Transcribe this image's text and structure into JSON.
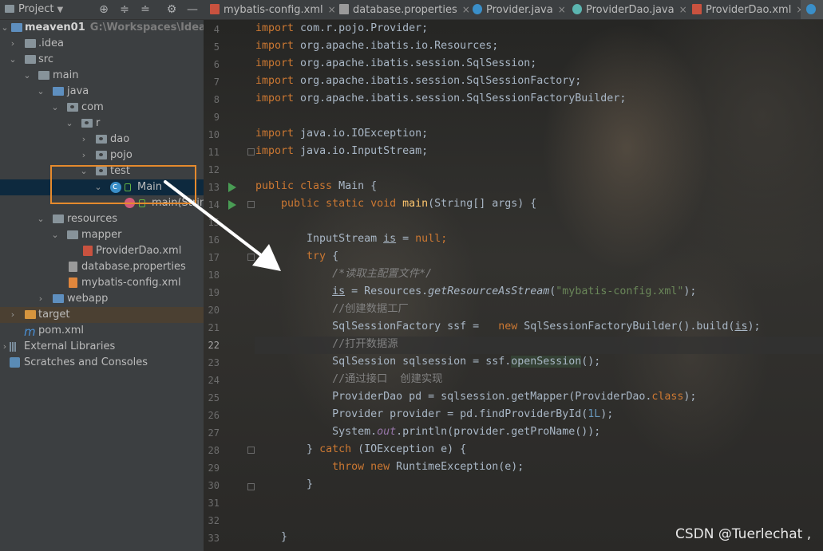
{
  "project_panel": {
    "title": "Project",
    "toolbar_icons": [
      "crosshair-icon",
      "expand-all-icon",
      "collapse-all-icon",
      "gear-icon",
      "hide-icon"
    ],
    "tree": [
      {
        "label": "meaven01",
        "path": "G:\\Workspaces\\IdeaProjec",
        "chevron": "down",
        "icon": "module-folder"
      },
      {
        "label": ".idea",
        "chevron": "right",
        "icon": "folder"
      },
      {
        "label": "src",
        "chevron": "down",
        "icon": "folder"
      },
      {
        "label": "main",
        "chevron": "down",
        "icon": "folder"
      },
      {
        "label": "java",
        "chevron": "down",
        "icon": "source-folder"
      },
      {
        "label": "com",
        "chevron": "down",
        "icon": "package"
      },
      {
        "label": "r",
        "chevron": "down",
        "icon": "package"
      },
      {
        "label": "dao",
        "chevron": "right",
        "icon": "package"
      },
      {
        "label": "pojo",
        "chevron": "right",
        "icon": "package"
      },
      {
        "label": "test",
        "chevron": "down",
        "icon": "package"
      },
      {
        "label": "Main",
        "chevron": "down",
        "icon": "class"
      },
      {
        "label": "main(Strin",
        "chevron": "",
        "icon": "method"
      },
      {
        "label": "resources",
        "chevron": "down",
        "icon": "resources-folder"
      },
      {
        "label": "mapper",
        "chevron": "down",
        "icon": "folder"
      },
      {
        "label": "ProviderDao.xml",
        "chevron": "",
        "icon": "xml-file"
      },
      {
        "label": "database.properties",
        "chevron": "",
        "icon": "properties-file"
      },
      {
        "label": "mybatis-config.xml",
        "chevron": "",
        "icon": "xml-file"
      },
      {
        "label": "webapp",
        "chevron": "right",
        "icon": "web-folder"
      },
      {
        "label": "target",
        "chevron": "right",
        "icon": "excluded-folder"
      },
      {
        "label": "pom.xml",
        "chevron": "",
        "icon": "maven-file"
      },
      {
        "label": "External Libraries",
        "chevron": "right",
        "icon": "libraries"
      },
      {
        "label": "Scratches and Consoles",
        "chevron": "",
        "icon": "scratches"
      }
    ]
  },
  "tabs": [
    {
      "label": "mybatis-config.xml",
      "icon": "xml-icon"
    },
    {
      "label": "database.properties",
      "icon": "properties-icon"
    },
    {
      "label": "Provider.java",
      "icon": "class-icon"
    },
    {
      "label": "ProviderDao.java",
      "icon": "interface-icon"
    },
    {
      "label": "ProviderDao.xml",
      "icon": "xml-icon"
    }
  ],
  "editor": {
    "line_numbers": [
      "4",
      "5",
      "6",
      "7",
      "8",
      "9",
      "10",
      "11",
      "12",
      "13",
      "14",
      "15",
      "16",
      "17",
      "18",
      "19",
      "20",
      "21",
      "22",
      "23",
      "24",
      "25",
      "26",
      "27",
      "28",
      "29",
      "30",
      "31",
      "32",
      "33"
    ],
    "current_line": "22",
    "tokens": {
      "l4a": "import",
      "l4b": " com.r.pojo.Provider;",
      "l5a": "import",
      "l5b": " org.apache.ibatis.io.Resources;",
      "l6a": "import",
      "l6b": " org.apache.ibatis.session.SqlSession;",
      "l7a": "import",
      "l7b": " org.apache.ibatis.session.SqlSessionFactory;",
      "l8a": "import",
      "l8b": " org.apache.ibatis.session.SqlSessionFactoryBuilder;",
      "l10a": "import",
      "l10b": " java.io.IOException;",
      "l11a": "import",
      "l11b": " java.io.InputStream;",
      "l13a": "public class",
      "l13b": " Main {",
      "l14a": "    public static void ",
      "l14b": "main",
      "l14c": "(String[] args) {",
      "l16a": "        InputStream ",
      "l16b": "is",
      "l16c": " = ",
      "l16d": "null",
      "l16e": ";",
      "l17a": "        try",
      "l17b": " {",
      "l18a": "            /*读取主配置文件*/",
      "l19a": "            ",
      "l19b": "is",
      "l19c": " = Resources.",
      "l19d": "getResourceAsStream",
      "l19e": "(",
      "l19f": "\"mybatis-config.xml\"",
      "l19g": ");",
      "l20a": "            //创建数据工厂",
      "l21a": "            SqlSessionFactory ssf =   ",
      "l21b": "new",
      "l21c": " SqlSessionFactoryBuilder().build(",
      "l21d": "is",
      "l21e": ");",
      "l22a": "            //打开数据源",
      "l23a": "            SqlSession sqlsession = ssf.",
      "l23b": "openSession",
      "l23c": "();",
      "l24a": "            //通过接口  创建实现",
      "l25a": "            ProviderDao pd = sqlsession.getMapper(ProviderDao.",
      "l25b": "class",
      "l25c": ");",
      "l26a": "            Provider provider = pd.findProviderById(",
      "l26b": "1L",
      "l26c": ");",
      "l27a": "            System.",
      "l27b": "out",
      "l27c": ".println(provider.getProName());",
      "l28a": "        } ",
      "l28b": "catch",
      "l28c": " (IOException e) {",
      "l29a": "            ",
      "l29b": "throw new",
      "l29c": " RuntimeException(e);",
      "l30a": "        }",
      "l32a": "    }"
    }
  },
  "watermark": "CSDN @Tuerlechat ,",
  "colors": {
    "keyword": "#cc7832",
    "method": "#ffc66d",
    "string": "#6a8759",
    "comment": "#808080",
    "number": "#6897bb",
    "field": "#9876aa",
    "highlight_box": "#e58a2d",
    "annotation_arrow": "#ffffff"
  }
}
